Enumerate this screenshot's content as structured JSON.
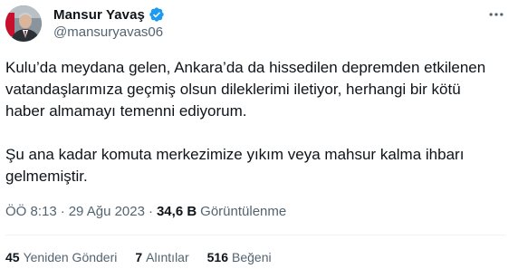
{
  "author": {
    "display_name": "Mansur Yavaş",
    "handle": "@mansuryavas06",
    "verified": true
  },
  "tweet": {
    "paragraphs": [
      "Kulu’da meydana gelen, Ankara’da da hissedilen depremden etkilenen vatandaşlarımıza geçmiş olsun dileklerimi iletiyor, herhangi bir kötü haber almamayı temenni ediyorum.",
      "Şu ana kadar komuta merkezimize yıkım veya mahsur kalma ihbarı gelmemiştir."
    ]
  },
  "meta": {
    "time": "ÖÖ 8:13",
    "separator": "·",
    "date": "29 Ağu 2023",
    "views_count": "34,6 B",
    "views_label": "Görüntülenme"
  },
  "stats": {
    "retweets_count": "45",
    "retweets_label": "Yeniden Gönderi",
    "quotes_count": "7",
    "quotes_label": "Alıntılar",
    "likes_count": "516",
    "likes_label": "Beğeni"
  },
  "colors": {
    "text_primary": "#0f1419",
    "text_secondary": "#536471",
    "verified_badge": "#1d9bf0",
    "divider": "#eff3f4"
  },
  "icons": {
    "verified": "verified-badge-icon",
    "more": "more-options-icon"
  }
}
